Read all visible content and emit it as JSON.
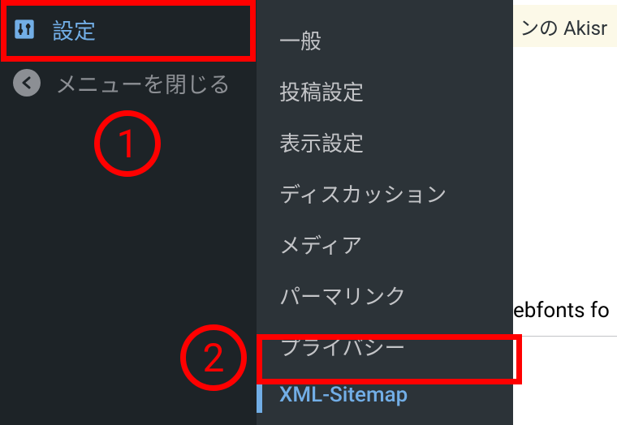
{
  "sidebar": {
    "settings_label": "設定",
    "collapse_label": "メニューを閉じる"
  },
  "submenu": {
    "items": [
      {
        "label": "一般"
      },
      {
        "label": "投稿設定"
      },
      {
        "label": "表示設定"
      },
      {
        "label": "ディスカッション"
      },
      {
        "label": "メディア"
      },
      {
        "label": "パーマリンク"
      },
      {
        "label": "プライバシー"
      },
      {
        "label": "XML-Sitemap"
      }
    ]
  },
  "content": {
    "top_notice": "ンの Akisr",
    "webfonts_text": "ebfonts fo"
  },
  "annotations": {
    "circle1": "1",
    "circle2": "2"
  }
}
